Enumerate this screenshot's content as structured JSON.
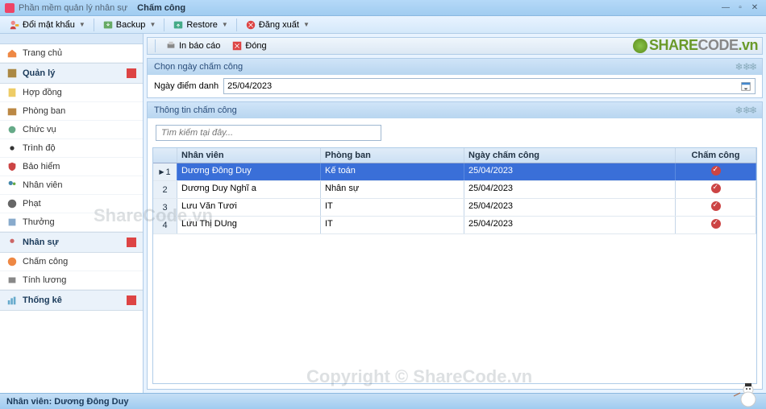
{
  "window": {
    "app_title": "Phần mềm quản lý nhân sự",
    "tab_title": "Chấm công"
  },
  "toolbar": {
    "change_pw": "Đổi mật khẩu",
    "backup": "Backup",
    "restore": "Restore",
    "logout": "Đăng xuất"
  },
  "sub_toolbar": {
    "print": "In báo cáo",
    "close": "Đóng"
  },
  "sidebar": {
    "home": "Trang chủ",
    "quanly_group": "Quản lý",
    "hopdong": "Hợp đồng",
    "phongban": "Phòng ban",
    "chucvu": "Chức vụ",
    "trinhdo": "Trình độ",
    "baohiem": "Bảo hiểm",
    "nhanvien": "Nhân viên",
    "phat": "Phạt",
    "thuong": "Thưởng",
    "nhansu_group": "Nhân sự",
    "chamcong": "Chấm công",
    "tinhluong": "Tính lương",
    "thongke_group": "Thống kê"
  },
  "panel1": {
    "title": "Chọn ngày chấm công",
    "label": "Ngày điểm danh",
    "date": "25/04/2023"
  },
  "panel2": {
    "title": "Thông tin chấm công",
    "search_placeholder": "Tìm kiếm tại đây..."
  },
  "grid": {
    "headers": {
      "name": "Nhân viên",
      "dept": "Phòng ban",
      "date": "Ngày chấm công",
      "check": "Chấm công"
    },
    "rows": [
      {
        "n": "1",
        "name": "Dương Đông Duy",
        "dept": "Kế toán",
        "date": "25/04/2023"
      },
      {
        "n": "2",
        "name": "Dương Duy Nghĩ a",
        "dept": "Nhân sự",
        "date": "25/04/2023"
      },
      {
        "n": "3",
        "name": "Lưu Văn Tươi",
        "dept": "IT",
        "date": "25/04/2023"
      },
      {
        "n": "4",
        "name": "Lưu Thị DUng",
        "dept": "IT",
        "date": "25/04/2023"
      }
    ]
  },
  "status": {
    "label": "Nhân viên:",
    "value": "Dương Đông Duy"
  },
  "brand": {
    "share": "SHARE",
    "code": "CODE",
    "vn": ".vn"
  },
  "watermark": {
    "w1": "ShareCode.vn",
    "w2": "Copyright © ShareCode.vn"
  }
}
